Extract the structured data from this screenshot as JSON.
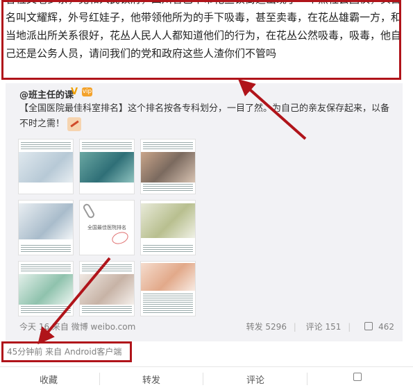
{
  "post": {
    "text": "各位父老乡亲，党和人民镇府，四川省巴中市花丛镇街道出现了一个黑社会团伙，头目名叫文耀辉，外号红娃子，他带领他所为的手下吸毒，甚至卖毒，在花丛雄霸一方，和当地派出所关系很好，花丛人民人人都知道他们的行为，在花丛公然吸毒，吸毒，他自己还是公务人员，请问我们的党和政府这些人渣你们不管吗",
    "time": "45分钟前",
    "source": "来自 Android客户端"
  },
  "repost": {
    "author": "@班主任的课",
    "verified_badge": "V",
    "vip_badge": "vip",
    "text": "【全国医院最佳科室排名】这个排名按各专科划分，一目了然。为自己的亲友保存起来，以备不时之需！",
    "image_center_label": "全国最佳医院排名",
    "footer": {
      "time": "今天 1",
      "time_suffix": "6",
      "source": "来自 微博 weibo.com",
      "repost_label": "转发 5296",
      "comment_label": "评论 151",
      "like_count": "462"
    }
  },
  "actions": {
    "favorite": "收藏",
    "repost": "转发",
    "comment": "评论"
  },
  "colors": {
    "highlight": "#b0141a",
    "card_bg": "#f2f2f5"
  }
}
